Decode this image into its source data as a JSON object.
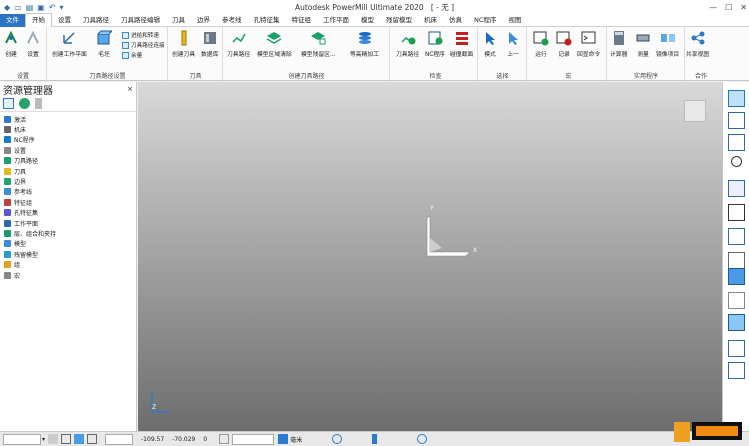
{
  "window": {
    "title": "Autodesk PowerMill Ultimate 2020",
    "doc_tag": "[ - 无 ]"
  },
  "tabs": [
    "文件",
    "开始",
    "设置",
    "刀具路径",
    "刀具路径编辑",
    "刀具",
    "边界",
    "参考线",
    "孔特征集",
    "特征组",
    "工作平面",
    "模型",
    "残留模型",
    "机床",
    "仿真",
    "NC程序",
    "视图"
  ],
  "active_tab": "开始",
  "ribbon": {
    "groups": [
      {
        "label": "设置",
        "buttons": [
          "创建",
          "设置"
        ]
      },
      {
        "label": "刀具路径设置",
        "buttons": [
          "创建工作平面",
          "毛坯"
        ],
        "small": [
          "进给和转速",
          "刀具路径连接",
          "余量"
        ]
      },
      {
        "label": "刀具",
        "buttons": [
          "创建刀具",
          "数据库"
        ]
      },
      {
        "label": "创建刀具路径",
        "buttons": [
          "刀具路径",
          "模型区域清除",
          "模型残留区...",
          "等高精加工"
        ]
      },
      {
        "label": "检查",
        "buttons": [
          "刀具路径",
          "NC程序",
          "碰撞截面"
        ]
      },
      {
        "label": "选择",
        "buttons": [
          "模式",
          "上一"
        ]
      },
      {
        "label": "宏",
        "buttons": [
          "运行",
          "记录",
          "回显命令"
        ]
      },
      {
        "label": "实用程序",
        "buttons": [
          "计算器",
          "测量",
          "镜像项目"
        ]
      },
      {
        "label": "合作",
        "buttons": [
          "共享视图"
        ]
      }
    ]
  },
  "explorer": {
    "title": "资源管理器",
    "items": [
      "激活",
      "机床",
      "NC程序",
      "设置",
      "刀具路径",
      "刀具",
      "边界",
      "参考线",
      "特征组",
      "孔特征集",
      "工作平面",
      "层、组合和夹持",
      "模型",
      "残留模型",
      "组",
      "宏"
    ]
  },
  "viewport": {
    "axis_x": "X",
    "axis_y": "Y",
    "axis_z": "Z"
  },
  "status": {
    "x": "-109.57",
    "y": "-70.029",
    "z": "0",
    "unit": "毫米"
  },
  "colors": {
    "accent": "#2b74c4",
    "file_tab": "#2b74c4"
  }
}
